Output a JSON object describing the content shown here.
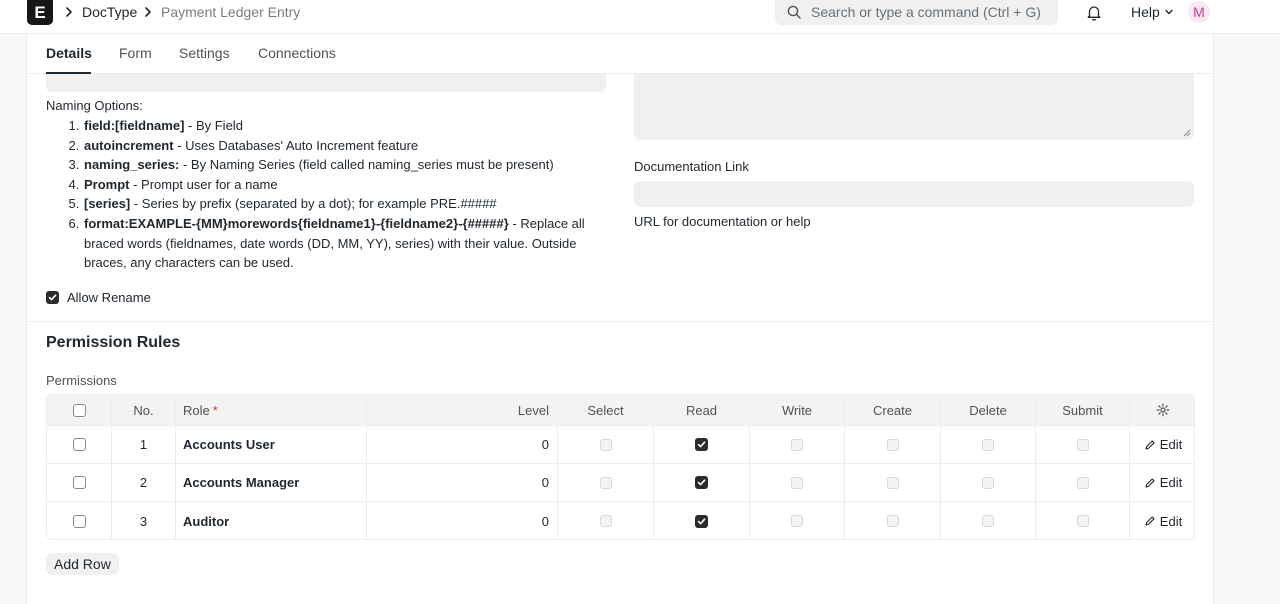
{
  "navbar": {
    "logo_letter": "E",
    "breadcrumbs": [
      "DocType",
      "Payment Ledger Entry"
    ],
    "search_placeholder": "Search or type a command (Ctrl + G)",
    "help_label": "Help",
    "avatar_initial": "M"
  },
  "tabs": [
    {
      "label": "Details",
      "active": true
    },
    {
      "label": "Form",
      "active": false
    },
    {
      "label": "Settings",
      "active": false
    },
    {
      "label": "Connections",
      "active": false
    }
  ],
  "naming": {
    "title": "Naming Options:",
    "items": [
      {
        "bold": "field:[fieldname]",
        "text": " - By Field"
      },
      {
        "bold": "autoincrement",
        "text": " - Uses Databases' Auto Increment feature"
      },
      {
        "bold": "naming_series:",
        "text": " - By Naming Series (field called naming_series must be present)"
      },
      {
        "bold": "Prompt",
        "text": " - Prompt user for a name"
      },
      {
        "bold": "[series]",
        "text": " - Series by prefix (separated by a dot); for example PRE.#####"
      },
      {
        "bold": "format:EXAMPLE-{MM}morewords{fieldname1}-{fieldname2}-{#####}",
        "text": " - Replace all braced words (fieldnames, date words (DD, MM, YY), series) with their value. Outside braces, any characters can be used."
      }
    ]
  },
  "documentation": {
    "label": "Documentation Link",
    "value": "",
    "help": "URL for documentation or help"
  },
  "allow_rename": {
    "label": "Allow Rename",
    "checked": true
  },
  "permissions": {
    "section_title": "Permission Rules",
    "field_label": "Permissions",
    "columns": [
      "No.",
      "Role",
      "Level",
      "Select",
      "Read",
      "Write",
      "Create",
      "Delete",
      "Submit"
    ],
    "role_required_mark": "*",
    "edit_label": "Edit",
    "rows": [
      {
        "no": "1",
        "role": "Accounts User",
        "level": "0",
        "select": false,
        "read": true,
        "write": false,
        "create": false,
        "delete": false,
        "submit": false
      },
      {
        "no": "2",
        "role": "Accounts Manager",
        "level": "0",
        "select": false,
        "read": true,
        "write": false,
        "create": false,
        "delete": false,
        "submit": false
      },
      {
        "no": "3",
        "role": "Auditor",
        "level": "0",
        "select": false,
        "read": true,
        "write": false,
        "create": false,
        "delete": false,
        "submit": false
      }
    ],
    "add_row_label": "Add Row"
  }
}
